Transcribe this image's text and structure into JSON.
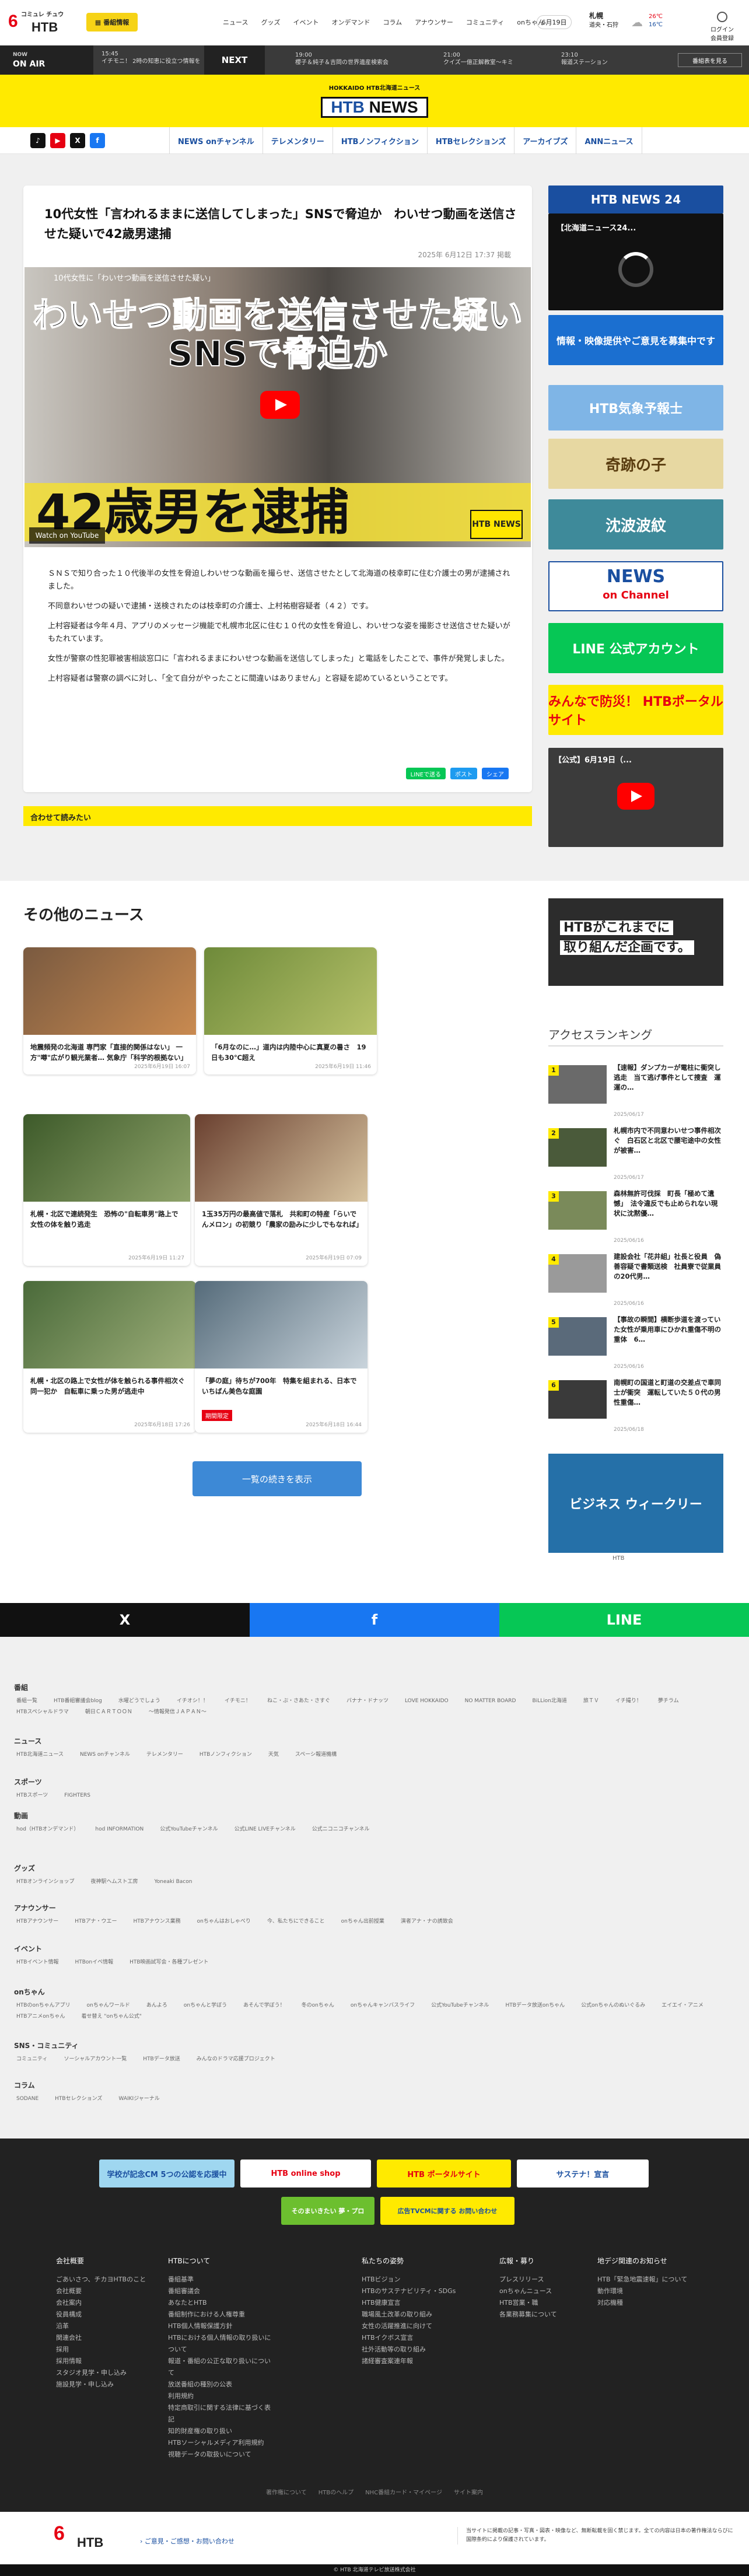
{
  "header": {
    "logo_tag": "コミュレ チュウ",
    "logo_num": "6",
    "logo_text": "HTB",
    "bangumi": "番組情報",
    "nav": [
      "ニュース",
      "グッズ",
      "イベント",
      "オンデマンド",
      "コラム",
      "アナウンサー",
      "コミュニティ",
      "onちゃん"
    ],
    "day": "6月19日",
    "area": "札幌",
    "area_sub": "道央・石狩",
    "temp_hi": "26℃",
    "temp_lo": "16℃",
    "login": "ログイン",
    "login2": "会員登録"
  },
  "onair": {
    "badge": "NOW",
    "badge2": "ON AIR",
    "now_time": "15:45",
    "now_title": "イチモニ！ 2時の知恵に役立つ情報を",
    "next": "NEXT",
    "items": [
      {
        "time": "19:00",
        "title": "櫻子＆純子＆吉岡の世界遺産検索会"
      },
      {
        "time": "21:00",
        "title": "クイズ一億正解教室〜キミ"
      },
      {
        "time": "23:10",
        "title": "報道ステーション"
      }
    ],
    "list_btn": "番組表を見る"
  },
  "brand": {
    "label": "HOKKAIDO HTB北海道ニュース",
    "name_a": "HTB",
    "name_b": "NEWS"
  },
  "social": [
    "TikTok",
    "YouTube",
    "X",
    "Facebook"
  ],
  "mainnav": [
    "NEWS onチャンネル",
    "テレメンタリー",
    "HTBノンフィクション",
    "HTBセレクションズ",
    "アーカイブズ",
    "ANNニュース"
  ],
  "article": {
    "title": "10代女性「言われるままに送信してしまった」SNSで脅迫か　わいせつ動画を送信させた疑いで42歳男逮捕",
    "date": "2025年 6月12日 17:37 掲載",
    "video_title": "10代女性に「わいせつ動画を送信させた疑い」",
    "caption1": "わいせつ動画を送信させた疑い",
    "caption2": "SNSで脅迫か",
    "caption3": "42歳男を逮捕",
    "video_logo": "HTB NEWS",
    "watch": "Watch on YouTube",
    "body": [
      "ＳＮＳで知り合った１０代後半の女性を脅迫しわいせつな動画を撮らせ、送信させたとして北海道の枝幸町に住む介護士の男が逮捕されました。",
      "不同意わいせつの疑いで逮捕・送検されたのは枝幸町の介護士、上村祐樹容疑者（４２）です。",
      "上村容疑者は今年４月、アプリのメッセージ機能で札幌市北区に住む１０代の女性を脅迫し、わいせつな姿を撮影させ送信させた疑いがもたれています。",
      "女性が警察の性犯罪被害相談窓口に「言われるままにわいせつな動画を送信してしまった」と電話をしたことで、事件が発覚しました。",
      "上村容疑者は警察の調べに対し、「全て自分がやったことに間違いはありません」と容疑を認めているということです。"
    ],
    "share": [
      "LINEで送る",
      "ポスト",
      "シェア"
    ]
  },
  "readmore": "合わせて読みたい",
  "sidebar": {
    "b1": "HTB NEWS 24",
    "b2": "【北海道ニュース24...",
    "b3": "情報・映像提供やご意見を募集中です",
    "b4": "HTB気象予報士",
    "b5": "奇跡の子",
    "b6": "沈波波紋",
    "b7a": "NEWS",
    "b7b": "on Channel",
    "b8": "LINE 公式アカウント",
    "b9": "みんなで防災！ HTBポータルサイト",
    "b10": "【公式】6月19日（..."
  },
  "other": {
    "title": "その他のニュース",
    "cards": [
      {
        "title": "地震頻発の北海道 専門家「直接的関係はない」 一方\"噂\"広がり観光業者… 気象庁「科学的根拠ない」",
        "date": "2025年6月19日 16:07",
        "tag": ""
      },
      {
        "title": "「6月なのに…」道内は内陸中心に真夏の暑さ　19日も30℃超え",
        "date": "2025年6月19日 11:46",
        "tag": ""
      },
      {
        "title": "札幌・北区で連続発生　恐怖の\"自転車男\"路上で女性の体を触り逃走",
        "date": "2025年6月19日 11:27",
        "tag": ""
      },
      {
        "title": "1玉35万円の最高値で落札　共和町の特産「らいでんメロン」の初競り「農家の励みに少しでもなれば」",
        "date": "2025年6月19日 07:09",
        "tag": ""
      },
      {
        "title": "札幌・北区の路上で女性が体を触られる事件相次ぐ　同一犯か　自転車に乗った男が逃走中",
        "date": "2025年6月18日 17:26",
        "tag": ""
      },
      {
        "title": "「夢の庭」待ちが700年　特集を組まれる、日本でいちばん美色な庭園",
        "date": "2025年6月18日 16:44",
        "tag": "期間限定"
      }
    ],
    "more": "一覧の続きを表示"
  },
  "promo": {
    "line1": "HTBがこれまでに",
    "line2": "取り組んだ企画です。"
  },
  "ranking": {
    "title": "アクセスランキング",
    "items": [
      {
        "title": "【速報】ダンプカーが電柱に衝突し逃走　当て逃げ事件として捜査　運運の…",
        "date": "2025/06/17"
      },
      {
        "title": "札幌市内で不同意わいせつ事件相次ぐ　白石区と北区で腰宅途中の女性が被害…",
        "date": "2025/06/17"
      },
      {
        "title": "森林無許可伐採　町長「極めて遺憾」　法令違反でも止められない現状に沈黙優…",
        "date": "2025/06/16"
      },
      {
        "title": "建設会社「花井組」社長と役員　偽善容疑で書類送検　社員寮で従業員の20代男…",
        "date": "2025/06/16"
      },
      {
        "title": "【事故の瞬間】横断歩道を渡っていた女性が乗用車にひかれ重傷不明の重体　6…",
        "date": "2025/06/16"
      },
      {
        "title": "南幌町の国道と町道の交差点で車同士が衝突　運転していた５０代の男性重傷…",
        "date": "2025/06/18"
      }
    ],
    "video_title": "ビジネス ウィークリー",
    "video_cap": "HTB"
  },
  "sharebar": [
    "X",
    "f",
    "LINE"
  ],
  "sitemap": [
    {
      "h": "番組",
      "links": [
        "番組一覧",
        "HTB番組審議会blog",
        "水曜どうでしょう",
        "イチオシ！！",
        "イチモニ！",
        "ねこ・ぷ・さあた・さすぐ",
        "バナナ・ドナッツ",
        "LOVE HOKKAIDO",
        "NO MATTER BOARD",
        "BiLLion北海道",
        "旅ＴＶ",
        "イチ撮り！",
        "夢チラム",
        "HTBスペシャルドラマ",
        "朝日ＣＡＲＴＯＯＮ",
        "〜情報発信ＪＡＰＡＮ〜"
      ]
    },
    {
      "h": "ニュース",
      "links": [
        "HTB北海道ニュース",
        "NEWS onチャンネル",
        "テレメンタリー",
        "HTBノンフィクション",
        "天気",
        "スペーシ報道機構"
      ]
    },
    {
      "h": "スポーツ",
      "links": [
        "HTBスポーツ",
        "FIGHTERS"
      ]
    },
    {
      "h": "動画",
      "links": [
        "hod（HTBオンデマンド）",
        "hod INFORMATION",
        "公式YouTubeチャンネル",
        "公式LINE LIVEチャンネル",
        "公式ニコニコチャンネル"
      ]
    },
    {
      "h": "グッズ",
      "links": [
        "HTBオンラインショップ",
        "夜神駅ヘムスト工房",
        "Yoneaki Bacon"
      ]
    },
    {
      "h": "アナウンサー",
      "links": [
        "HTBアナウンサー",
        "HTBアナ・ウエー",
        "HTBアナウンス業務",
        "onちゃんはおしゃべり",
        "今、私たちにできること",
        "onちゃん出前授業",
        "演者アナ・ナの誘致会"
      ]
    },
    {
      "h": "イベント",
      "links": [
        "HTBイベント情報",
        "HTBonイベ情報",
        "HTB映画試写会・各種プレゼント"
      ]
    },
    {
      "h": "onちゃん",
      "links": [
        "HTBのonちゃんアプリ",
        "onちゃんワールド",
        "あんよろ",
        "onちゃんと学ぼう",
        "あそんで学ぼう！",
        "冬のonちゃん",
        "onちゃんキャンバスライフ",
        "公式YouTubeチャンネル",
        "HTBデータ放送onちゃん",
        "公式onちゃんのぬいぐるみ",
        "エイエイ・アニメ",
        "HTBアニメonちゃん",
        "着せ替え \"onちゃん公式\""
      ]
    },
    {
      "h": "SNS・コミュニティ",
      "links": [
        "コミュニティ",
        "ソーシャルアカウント一覧",
        "HTBデータ放送",
        "みんなのドラマ応援プロジェクト"
      ]
    },
    {
      "h": "コラム",
      "links": [
        "SODANE",
        "HTBセレクションズ",
        "WAIKIジャーナル"
      ]
    }
  ],
  "footer": {
    "banners": [
      "学校が記念CM 5つの公認を応援中",
      "HTB online shop",
      "HTB ポータルサイト",
      "サステナ！宣言",
      "そのまいきたい 夢・プロ",
      "広告TVCMに関する お問い合わせ"
    ],
    "cols": [
      {
        "h": "会社概要",
        "items": [
          "ごあいさつ、チカヨHTBのこと",
          "会社概要",
          "会社案内",
          "役員構成",
          "沿革",
          "関連会社",
          "採用",
          "採用情報",
          "スタジオ見学・申し込み",
          "施設見学・申し込み"
        ]
      },
      {
        "h": "HTBについて",
        "items": [
          "番組基準",
          "番組審議会",
          "あなたとHTB",
          "番組制作における人権尊重",
          "HTB個人情報保護方針",
          "HTBにおける個人情報の取り扱いについて",
          "報道・番組の公正な取り扱いについて",
          "放送番組の種別の公表",
          "利用規約",
          "特定商取引に関する法律に基づく表記",
          "知的財産権の取り扱い",
          "HTBソーシャルメディア利用規約",
          "視聴データの取扱いについて"
        ]
      },
      {
        "h": "私たちの姿勢",
        "items": [
          "HTBビジョン",
          "HTBのサステナビリティ・SDGs",
          "HTB健康宣言",
          "職場風土改革の取り組み",
          "女性の活躍推進に向けて",
          "HTBイクボス宣言",
          "社外活動等の取り組み",
          "諸経審査案連年報"
        ]
      },
      {
        "h": "広報・募り",
        "items": [
          "プレスリリース",
          "onちゃんニュース",
          "HTB営業・職",
          "各業務募集について"
        ]
      },
      {
        "h": "地デジ関連のお知らせ",
        "items": [
          "HTB「緊急地震速報」について",
          "動作環境",
          "対応機種"
        ]
      }
    ],
    "bottom": "著作権について　　HTBのヘルプ　　NHC番組カード・マイページ　　サイト案内",
    "note": "当サイトに掲載の記事・写真・図表・映像など、無断転載を固く禁じます。全ての内容は日本の著作権法ならびに国際条約により保護されています。",
    "contact": "› ご意見・ご感想・お問い合わせ",
    "copyright": "© HTB 北海道テレビ放送株式会社"
  }
}
